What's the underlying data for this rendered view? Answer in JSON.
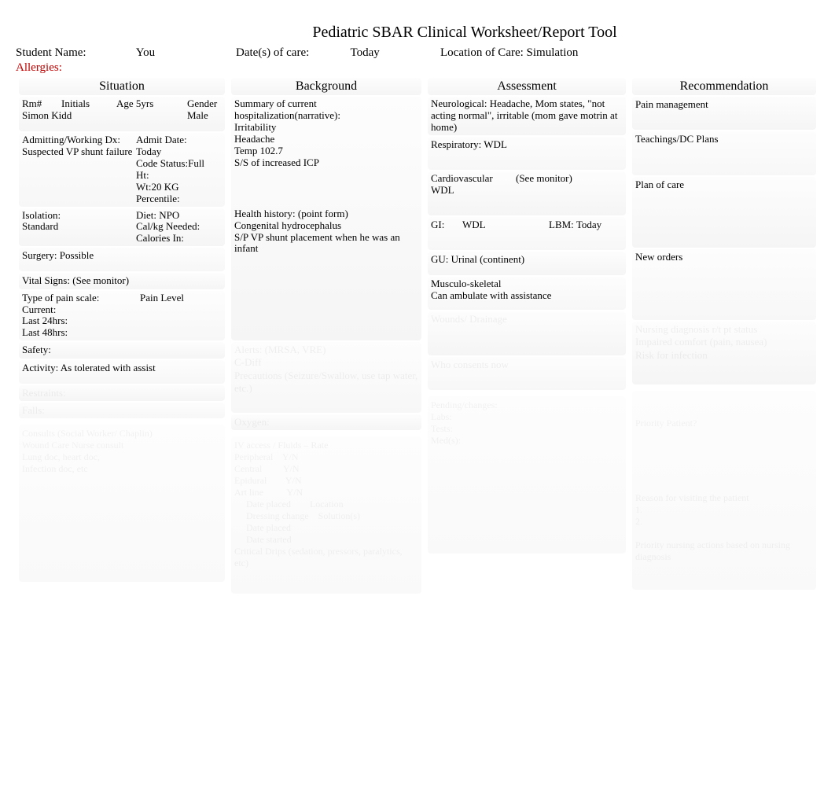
{
  "title": "Pediatric       SBAR Clinical Worksheet/Report Tool",
  "header": {
    "student_label": "Student Name:",
    "student_value": "You",
    "dates_label": "Date(s) of care:",
    "dates_value": "Today",
    "location_label": "Location of Care:",
    "location_value": "Simulation"
  },
  "allergies_label": "Allergies:",
  "columns": {
    "situation": "Situation",
    "background": "Background",
    "assessment": "Assessment",
    "recommendation": "Recommendation"
  },
  "situation": {
    "rm_label": "Rm#",
    "initials_label": "Initials",
    "initials_value": "Simon Kidd",
    "age_label": "Age",
    "age_value": "5yrs",
    "gender_label": "Gender",
    "gender_value": "Male",
    "admit_dx_label": "Admitting/Working Dx:",
    "admit_dx_value": "Suspected VP shunt failure",
    "admit_date_label": "Admit Date:",
    "admit_date_value": "Today",
    "code_status_label": "Code Status:",
    "code_status_value": "Full",
    "ht_label": "Ht:",
    "wt_label": "Wt:",
    "wt_value": "20 KG",
    "percentile_label": "Percentile:",
    "isolation_label": "Isolation:",
    "isolation_value": "Standard",
    "diet_label": "Diet:",
    "diet_value": "NPO",
    "calkg_label": "Cal/kg Needed:",
    "calin_label": "Calories In:",
    "surgery_label": "Surgery:",
    "surgery_value": "Possible",
    "vitals_label": "Vital Signs:",
    "vitals_value": "(See monitor)",
    "pain_type_label": "Type of pain scale:",
    "pain_level_label": "Pain Level",
    "current_label": "Current:",
    "last24_label": "Last 24hrs:",
    "last48_label": "Last 48hrs:",
    "safety_label": "Safety:",
    "activity_label": "Activity:",
    "activity_value": "As tolerated with assist",
    "restraints_faded": "Restraints:",
    "falls_faded": "Falls:",
    "consults_faded": "Consults (Social Worker/ Chaplin)\nWound Care Nurse consult\nLung doc, heart doc,\nInfection doc, etc"
  },
  "background": {
    "summary_label": "Summary of current hospitalization(narrative):",
    "summary_lines": [
      "Irritability",
      "Headache",
      "Temp 102.7",
      "S/S of increased ICP"
    ],
    "health_hx_label": "Health history: (point form)",
    "health_hx_lines": [
      "Congenital hydrocephalus",
      "S/P VP shunt placement when he was an infant"
    ],
    "alerts_faded": "Alerts: (MRSA, VRE)\nC-Diff\nPrecautions (Seizure/Swallow, use tap water, etc.)",
    "oxygen_faded": "Oxygen:",
    "iv_faded": "IV access / Fluids – Rate\nPeripheral    Y/N\nCentral         Y/N\nEpidural        Y/N\nArt line          Y/N\n     Date placed        Location\n     Dressing change    Solution(s)\n     Date placed\n     Date started\nCritical Drips (sedation, pressors, paralytics, etc)"
  },
  "assessment": {
    "neuro_label": "Neurological:",
    "neuro_value": "Headache, Mom states, \"not acting normal\", irritable (mom gave motrin at home)",
    "resp_label": "Respiratory:",
    "resp_value": "WDL",
    "cardio_label": "Cardiovascular",
    "cardio_note": "(See monitor)",
    "cardio_value": "WDL",
    "gi_label": "GI:",
    "gi_value": "WDL",
    "lbm_label": "LBM:",
    "lbm_value": "Today",
    "gu_label": "GU:",
    "gu_value": "Urinal (continent)",
    "musculo_label": "Musculo-skeletal",
    "musculo_value": "Can ambulate with assistance",
    "wounds_faded": "Wounds/ Drainage",
    "psych_faded": "Who consents now",
    "pending_faded": "Pending/changes:\nLabs:\nTests:\nMed(s):"
  },
  "recommendation": {
    "pain_label": "Pain management",
    "teach_label": "Teachings/DC Plans",
    "plan_label": "Plan of care",
    "orders_label": "New orders",
    "faded1": "Nursing diagnosis r/t pt status\nImpaired comfort (pain, nausea)\nRisk for infection",
    "priority_faded": "Priority Patient?",
    "reason_faded": "Reason for visiting the patient\n1.\n2.\n\nPriority nursing actions based on nursing diagnosis"
  }
}
